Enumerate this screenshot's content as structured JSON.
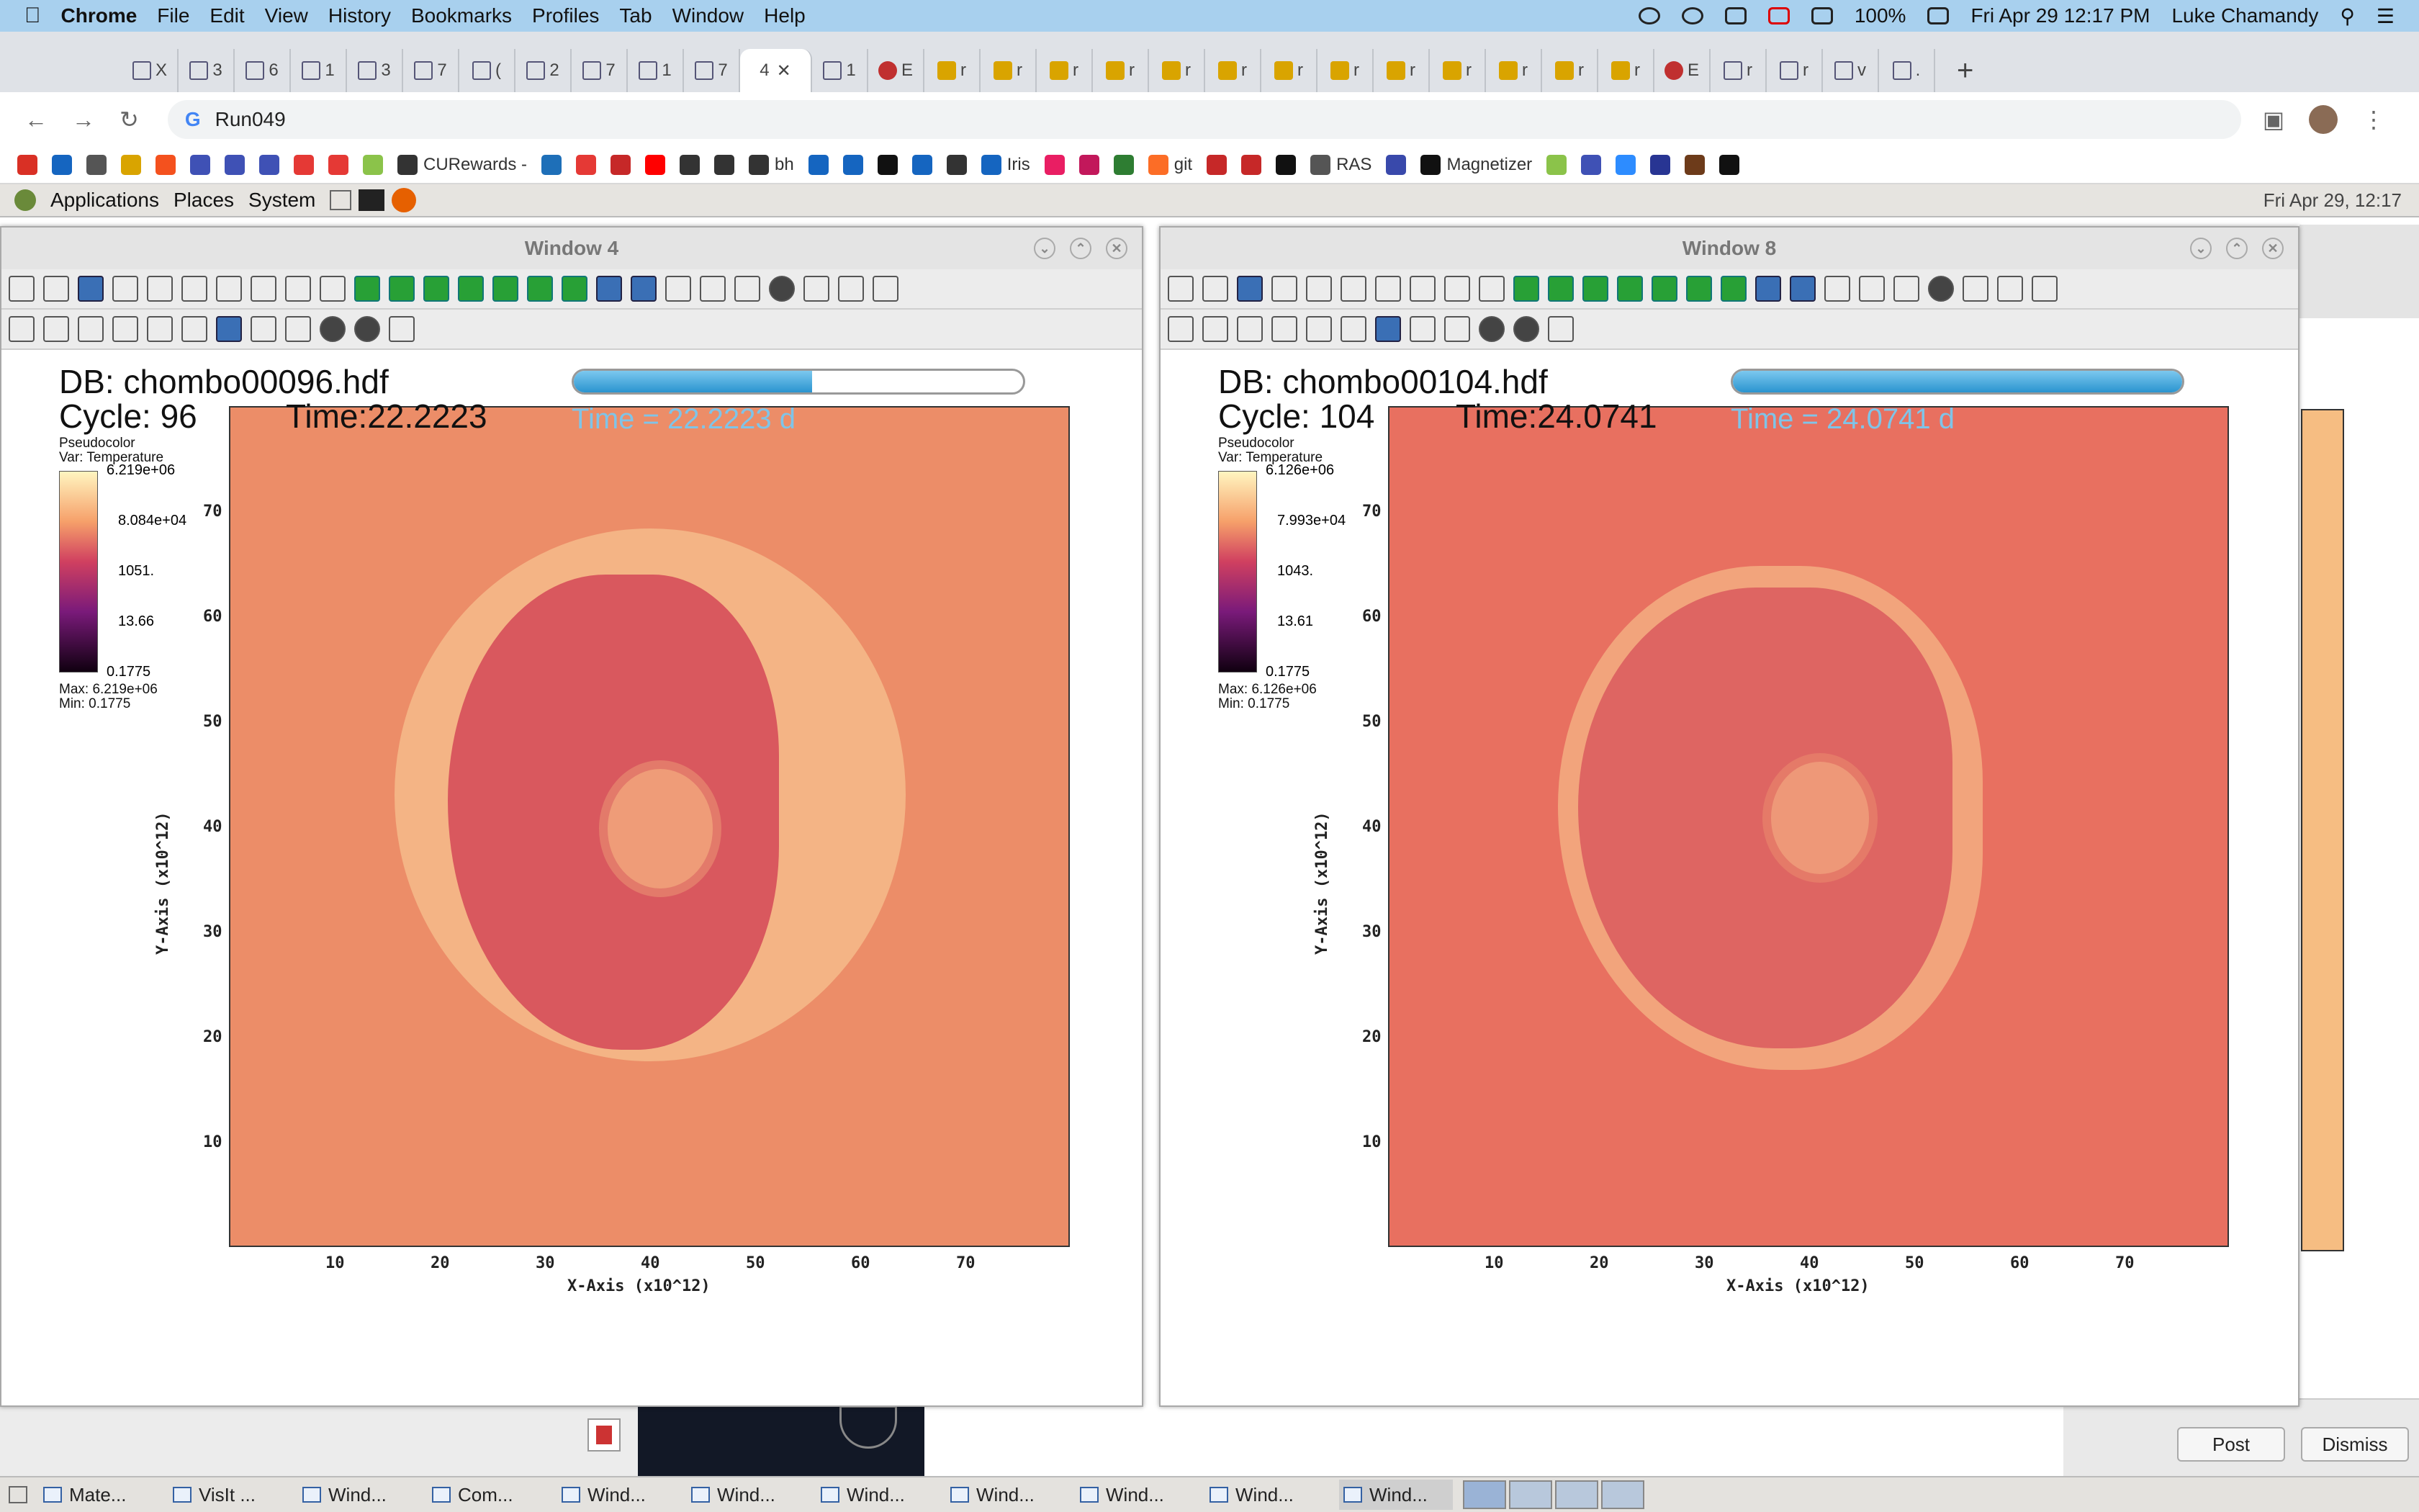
{
  "menubar": {
    "app": "Chrome",
    "items": [
      "File",
      "Edit",
      "View",
      "History",
      "Bookmarks",
      "Profiles",
      "Tab",
      "Window",
      "Help"
    ],
    "battery": "100%",
    "datetime": "Fri Apr 29  12:17 PM",
    "user": "Luke Chamandy"
  },
  "tabs": [
    {
      "label": "X",
      "fav": "x"
    },
    {
      "label": "3",
      "fav": "x"
    },
    {
      "label": "6",
      "fav": "x"
    },
    {
      "label": "1",
      "fav": "x"
    },
    {
      "label": "3",
      "fav": "x"
    },
    {
      "label": "7",
      "fav": "x"
    },
    {
      "label": "(",
      "fav": "x"
    },
    {
      "label": "2",
      "fav": "x"
    },
    {
      "label": "7",
      "fav": "x"
    },
    {
      "label": "1",
      "fav": "x"
    },
    {
      "label": "7",
      "fav": "x"
    },
    {
      "label": "4",
      "fav": "active"
    },
    {
      "label": "1",
      "fav": "x"
    },
    {
      "label": "E",
      "fav": "r"
    },
    {
      "label": "r",
      "fav": "y"
    },
    {
      "label": "r",
      "fav": "y"
    },
    {
      "label": "r",
      "fav": "y"
    },
    {
      "label": "r",
      "fav": "y"
    },
    {
      "label": "r",
      "fav": "y"
    },
    {
      "label": "r",
      "fav": "y"
    },
    {
      "label": "r",
      "fav": "y"
    },
    {
      "label": "r",
      "fav": "y"
    },
    {
      "label": "r",
      "fav": "y"
    },
    {
      "label": "r",
      "fav": "y"
    },
    {
      "label": "r",
      "fav": "y"
    },
    {
      "label": "r",
      "fav": "y"
    },
    {
      "label": "r",
      "fav": "y"
    },
    {
      "label": "E",
      "fav": "r"
    },
    {
      "label": "r",
      "fav": "x"
    },
    {
      "label": "r",
      "fav": "x"
    },
    {
      "label": "v",
      "fav": "x"
    },
    {
      "label": ".",
      "fav": "x"
    }
  ],
  "address": {
    "url": "Run049"
  },
  "bookmarks": [
    {
      "label": "",
      "c": "#d93025"
    },
    {
      "label": "",
      "c": "#1565c0"
    },
    {
      "label": "",
      "c": "#555"
    },
    {
      "label": "",
      "c": "#d9a400"
    },
    {
      "label": "",
      "c": "#f4511e"
    },
    {
      "label": "",
      "c": "#3f51b5"
    },
    {
      "label": "",
      "c": "#3f51b5"
    },
    {
      "label": "",
      "c": "#3f51b5"
    },
    {
      "label": "",
      "c": "#e53935"
    },
    {
      "label": "",
      "c": "#e53935"
    },
    {
      "label": "",
      "c": "#8bc34a"
    },
    {
      "label": "CURewards -",
      "c": "#333"
    },
    {
      "label": "",
      "c": "#1e6fb8"
    },
    {
      "label": "",
      "c": "#e53935"
    },
    {
      "label": "",
      "c": "#c62828"
    },
    {
      "label": "",
      "c": "#ff0000"
    },
    {
      "label": "",
      "c": "#333"
    },
    {
      "label": "",
      "c": "#333"
    },
    {
      "label": "bh",
      "c": "#333"
    },
    {
      "label": "",
      "c": "#1565c0"
    },
    {
      "label": "",
      "c": "#1565c0"
    },
    {
      "label": "",
      "c": "#111"
    },
    {
      "label": "",
      "c": "#1565c0"
    },
    {
      "label": "",
      "c": "#333"
    },
    {
      "label": "Iris",
      "c": "#1565c0"
    },
    {
      "label": "",
      "c": "#e91e63"
    },
    {
      "label": "",
      "c": "#c2185b"
    },
    {
      "label": "",
      "c": "#2e7d32"
    },
    {
      "label": "git",
      "c": "#fc6d26"
    },
    {
      "label": "",
      "c": "#c62828"
    },
    {
      "label": "",
      "c": "#c62828"
    },
    {
      "label": "",
      "c": "#111"
    },
    {
      "label": "RAS",
      "c": "#555"
    },
    {
      "label": "",
      "c": "#3949ab"
    },
    {
      "label": "Magnetizer",
      "c": "#111"
    },
    {
      "label": "",
      "c": "#8bc34a"
    },
    {
      "label": "",
      "c": "#3f51b5"
    },
    {
      "label": "",
      "c": "#2d8cff"
    },
    {
      "label": "",
      "c": "#283593"
    },
    {
      "label": "",
      "c": "#6d3b1a"
    },
    {
      "label": "",
      "c": "#111"
    }
  ],
  "gnome": {
    "items": [
      "Applications",
      "Places",
      "System"
    ],
    "clock": "Fri Apr 29, 12:17"
  },
  "win4": {
    "title": "Window 4",
    "db": "DB: chombo00096.hdf",
    "cycle": "Cycle: 96",
    "time": "Time:22.2223",
    "time_overlay": "Time = 22.2223 d",
    "progress": 0.53,
    "legend": {
      "l1": "Pseudocolor",
      "l2": "Var: Temperature",
      "t0": "6.219e+06",
      "t1": "8.084e+04",
      "t2": "1051.",
      "t3": "13.66",
      "t4": "0.1775",
      "max": "Max: 6.219e+06",
      "min": "Min: 0.1775"
    }
  },
  "win8": {
    "title": "Window 8",
    "db": "DB: chombo00104.hdf",
    "cycle": "Cycle: 104",
    "time": "Time:24.0741",
    "time_overlay": "Time = 24.0741 d",
    "progress": 1.0,
    "legend": {
      "l1": "Pseudocolor",
      "l2": "Var: Temperature",
      "t0": "6.126e+06",
      "t1": "7.993e+04",
      "t2": "1043.",
      "t3": "13.61",
      "t4": "0.1775",
      "max": "Max: 6.126e+06",
      "min": "Min: 0.1775"
    }
  },
  "axes": {
    "xlabel": "X-Axis (x10^12)",
    "ylabel": "Y-Axis (x10^12)",
    "xticks": [
      "10",
      "20",
      "30",
      "40",
      "50",
      "60",
      "70"
    ],
    "yticks": [
      "70",
      "60",
      "50",
      "40",
      "30",
      "20",
      "10"
    ]
  },
  "dialog": {
    "post": "Post",
    "dismiss": "Dismiss"
  },
  "taskbar": [
    "Mate...",
    "VisIt ...",
    "Wind...",
    "Com...",
    "Wind...",
    "Wind...",
    "Wind...",
    "Wind...",
    "Wind...",
    "Wind...",
    "Wind..."
  ]
}
